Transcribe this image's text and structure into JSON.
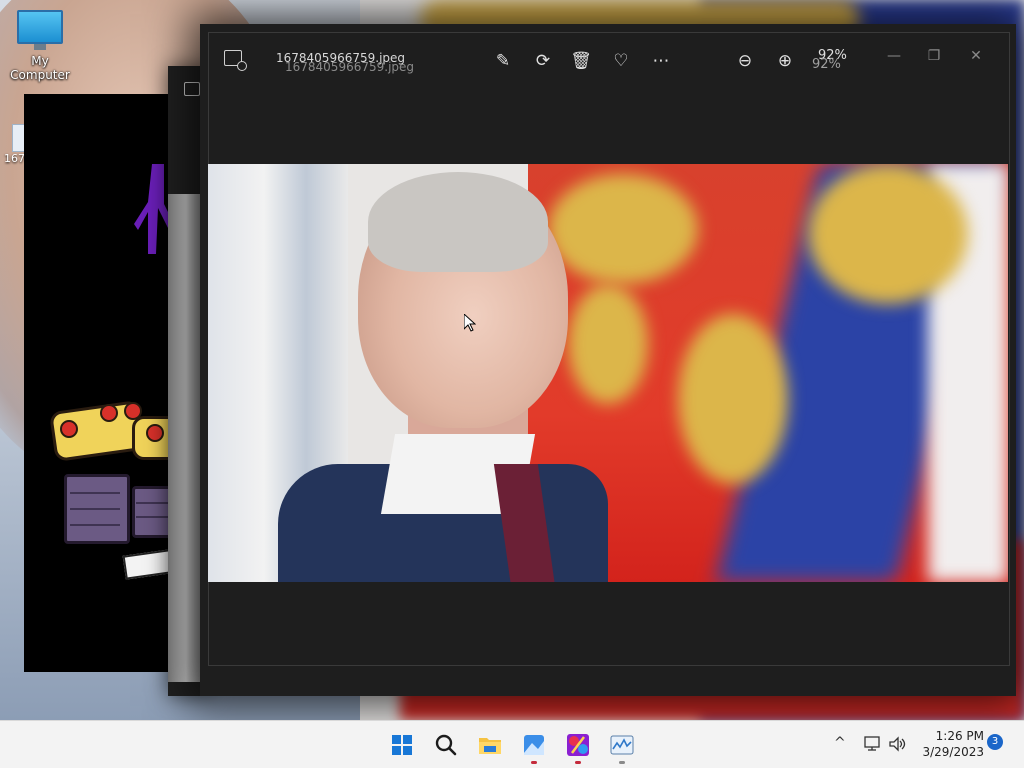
{
  "desktop": {
    "icons": [
      {
        "label": "My Computer",
        "icon": "monitor-icon"
      },
      {
        "label": "167",
        "icon": "file-icon"
      }
    ]
  },
  "photos_window": {
    "title": "1678405966759.jpeg",
    "title_ghost": "1678405966759.jpeg",
    "zoom": "92%",
    "zoom_ghost": "92%",
    "toolbar": [
      {
        "name": "edit-image-icon",
        "glyph": "✎"
      },
      {
        "name": "rotate-icon",
        "glyph": "⟳"
      },
      {
        "name": "delete-icon",
        "glyph": "🗑"
      },
      {
        "name": "favorite-icon",
        "glyph": "♡"
      },
      {
        "name": "more-icon",
        "glyph": "⋯"
      },
      {
        "name": "zoom-out-icon",
        "glyph": "⊖"
      },
      {
        "name": "zoom-in-icon",
        "glyph": "⊕"
      }
    ],
    "window_controls": {
      "minimize": "—",
      "maximize": "❐",
      "close": "✕"
    }
  },
  "taskbar": {
    "apps": [
      "start-icon",
      "search-icon",
      "file-explorer-icon",
      "photos-icon",
      "paint-app-icon",
      "task-manager-icon"
    ],
    "tray": {
      "chevron": "^",
      "network_icon": "network-icon",
      "volume_icon": "volume-icon",
      "time": "1:26 PM",
      "date": "3/29/2023",
      "notification_count": "3"
    }
  },
  "colors": {
    "taskbar_bg": "#f3f3f3",
    "window_bg": "#1e1e1e",
    "accent": "#1877d6"
  }
}
